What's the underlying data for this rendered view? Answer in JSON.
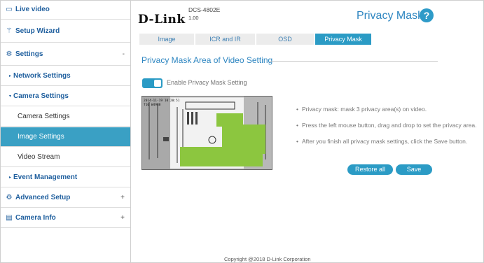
{
  "sidebar": {
    "live_video": {
      "icon": "video-icon",
      "label": "Live video"
    },
    "setup_wizard": {
      "icon": "wand-icon",
      "label": "Setup Wizard"
    },
    "settings": {
      "icon": "gear-icon",
      "label": "Settings",
      "toggle": "-"
    },
    "network_settings": {
      "label": "Network Settings"
    },
    "camera_settings_group": {
      "label": "Camera Settings"
    },
    "camera_settings": {
      "label": "Camera Settings"
    },
    "image_settings": {
      "label": "Image Settings"
    },
    "video_stream": {
      "label": "Video Stream"
    },
    "event_management": {
      "label": "Event Management"
    },
    "advanced_setup": {
      "icon": "advanced-gear-icon",
      "label": "Advanced Setup",
      "toggle": "+"
    },
    "camera_info": {
      "icon": "info-doc-icon",
      "label": "Camera Info",
      "toggle": "+"
    }
  },
  "header": {
    "brand": "D-Link",
    "model": "DCS-4802E",
    "firmware": "1.00",
    "page_title": "Privacy Mask",
    "help_glyph": "?"
  },
  "tabs": [
    {
      "label": "Image",
      "active": false
    },
    {
      "label": "ICR and IR",
      "active": false
    },
    {
      "label": "OSD",
      "active": false
    },
    {
      "label": "Privacy Mask",
      "active": true
    }
  ],
  "section": {
    "title": "Privacy Mask Area of Video Setting",
    "enable_label": "Enable Privacy Mask Setting",
    "enable_on": true
  },
  "video": {
    "timestamp_line1": "2014-11-19 10:20:51",
    "timestamp_line2": "T10 W4988",
    "mask_color": "#8cc63f"
  },
  "notes": [
    "Privacy mask: mask 3 privacy area(s) on video.",
    "Press the left mouse button, drag and drop to set the privacy area.",
    "After you finish all privacy mask settings, click the Save button."
  ],
  "buttons": {
    "restore_all": "Restore all",
    "save": "Save"
  },
  "footer": {
    "copyright": "Copyright @2018 D-Link Corporation"
  },
  "colors": {
    "accent": "#2b9bc5",
    "title_blue": "#2e86c1",
    "sidebar_link": "#1f5f9e"
  }
}
